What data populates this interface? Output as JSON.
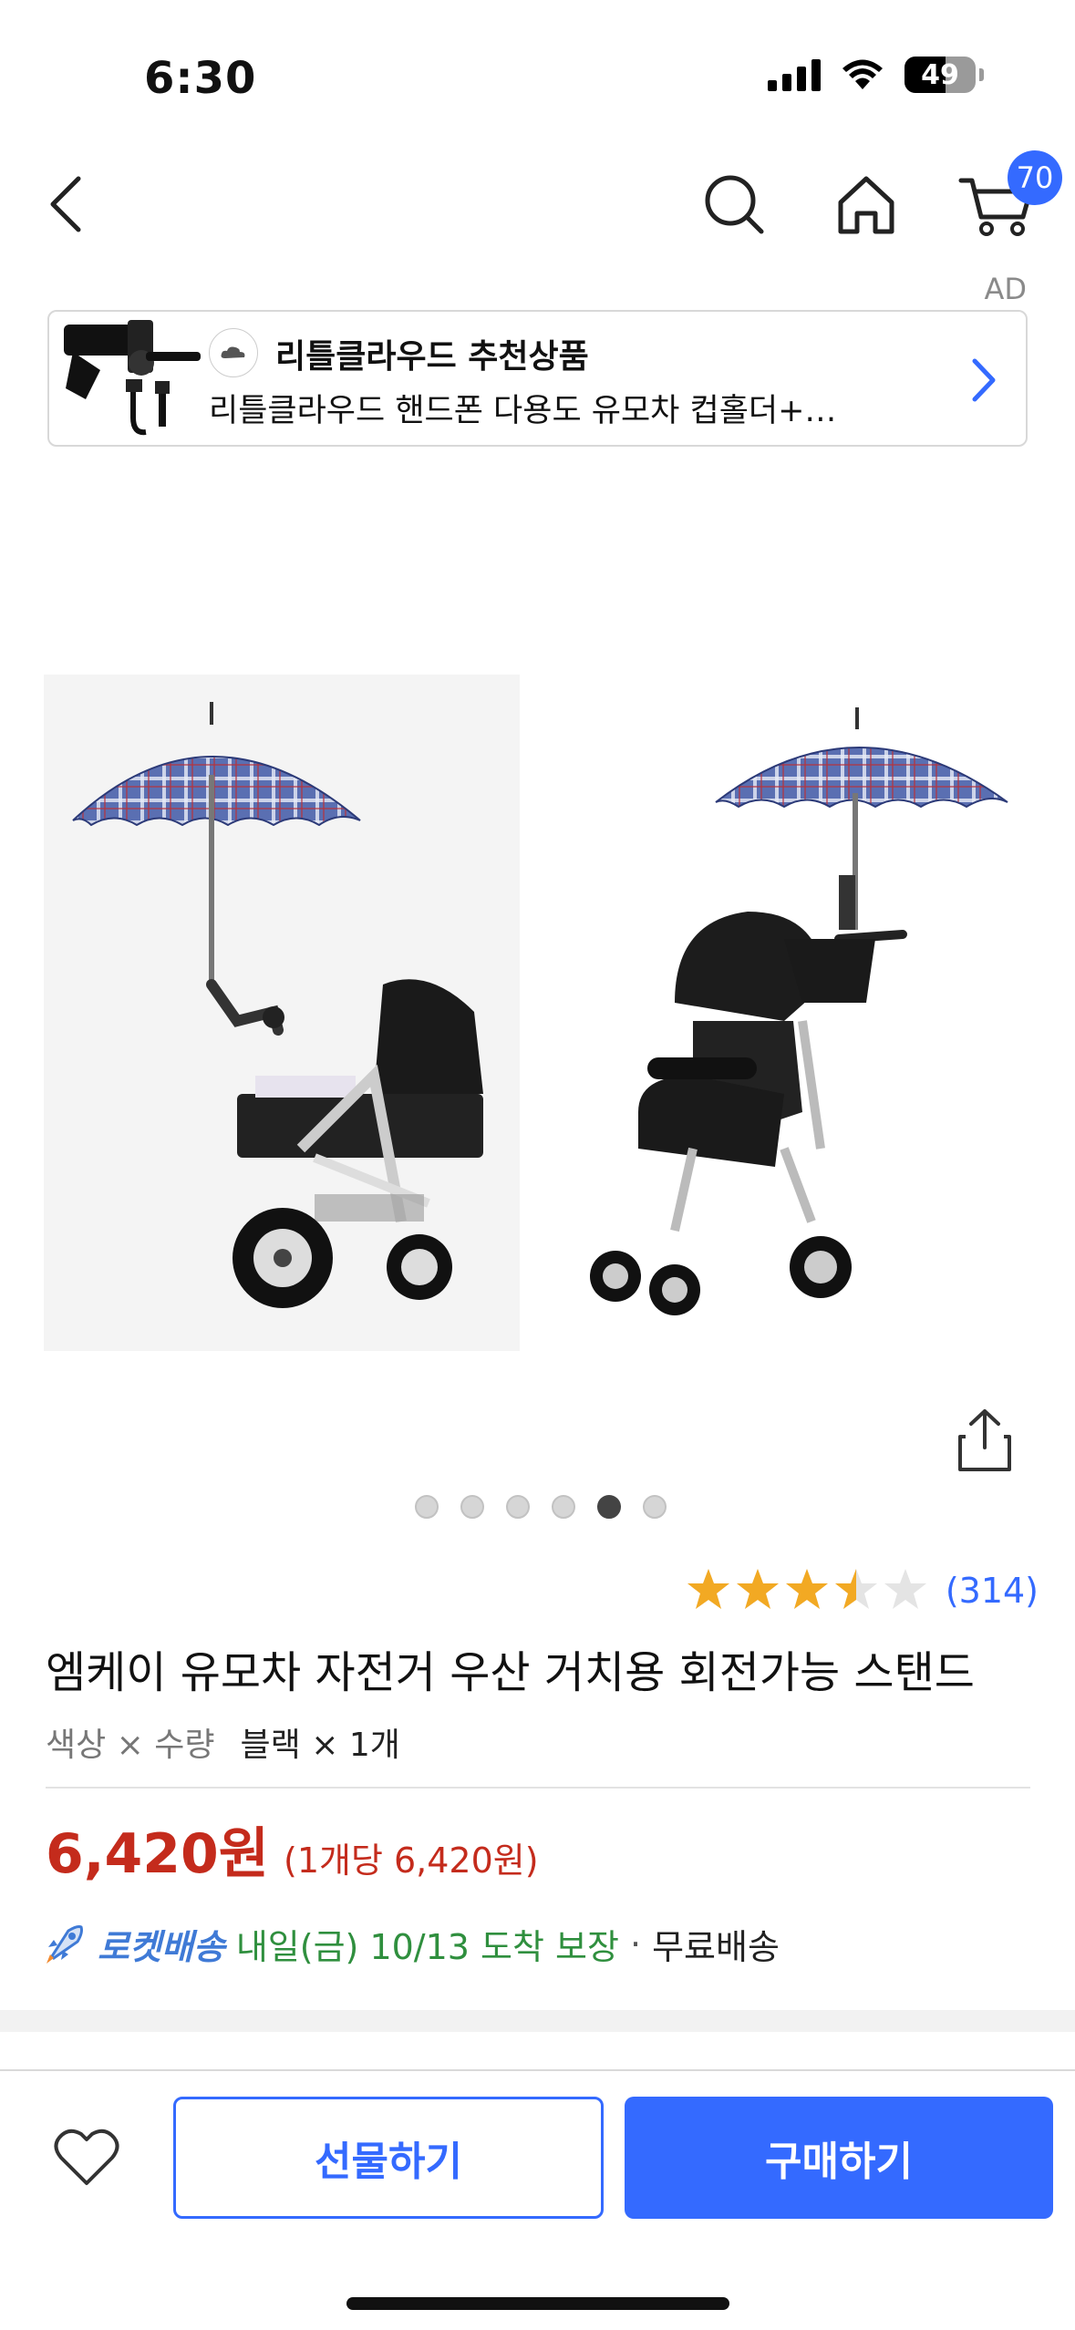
{
  "status_bar": {
    "time": "6:30",
    "battery": "49"
  },
  "nav": {
    "cart_count": "70"
  },
  "ad": {
    "label": "AD",
    "title": "리틀클라우드 추천상품",
    "description": "리틀클라우드 핸드폰 다용도 유모차 컵홀더+…"
  },
  "gallery": {
    "total_dots": 6,
    "active_index": 4
  },
  "product": {
    "rating": 3.5,
    "review_count": "(314)",
    "title": "엠케이 유모차 자전거 우산 거치용 회전가능 스탠드",
    "option_label": "색상 × 수량",
    "option_value": "블랙 × 1개",
    "price": "6,420원",
    "unit_price": "(1개당 6,420원)"
  },
  "delivery": {
    "rocket_label": "로켓배송",
    "date": "내일(금) 10/13 도착 보장",
    "separator": "·",
    "shipping": "무료배송"
  },
  "actions": {
    "gift": "선물하기",
    "buy": "구매하기"
  },
  "colors": {
    "accent": "#346aff",
    "price": "#c42b1c",
    "delivery": "#2f8f3e",
    "star": "#f2a923"
  }
}
